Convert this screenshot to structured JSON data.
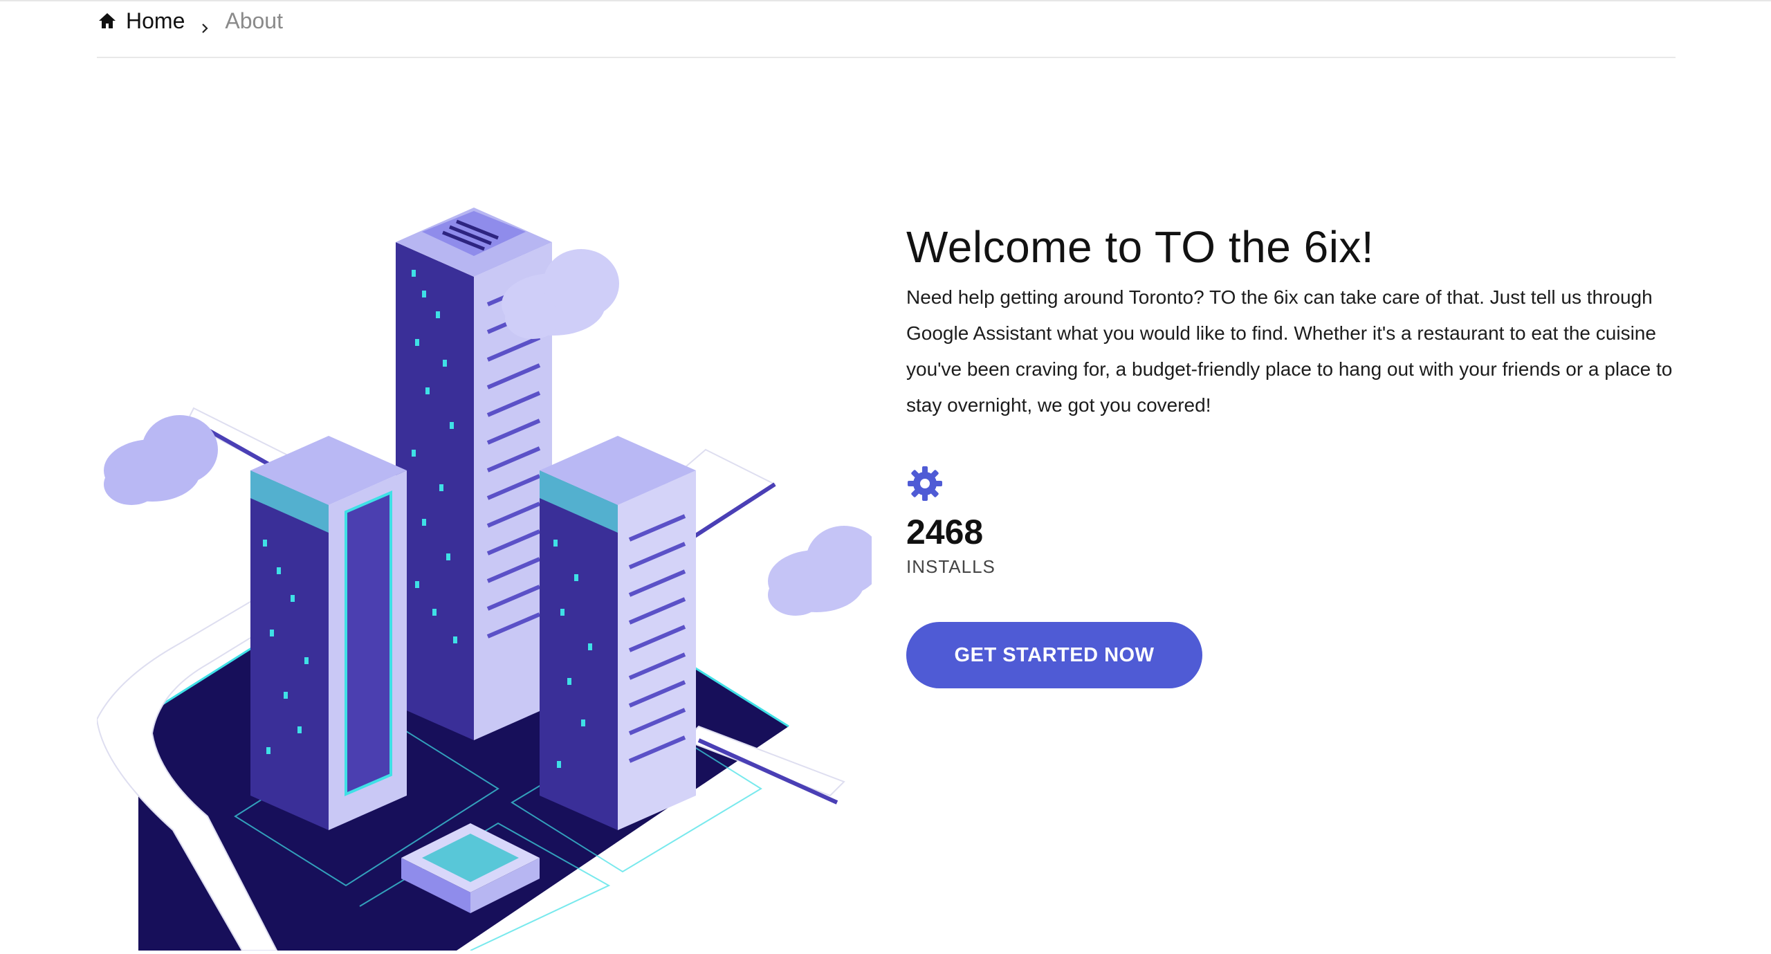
{
  "breadcrumb": {
    "home_icon": "home-icon",
    "home_label": "Home",
    "separator_icon": "chevron-right-icon",
    "current_label": "About"
  },
  "hero": {
    "title": "Welcome to TO the 6ix!",
    "description": "Need help getting around Toronto? TO the 6ix can take care of that. Just tell us through Google Assistant what you would like to find. Whether it's a restaurant to eat the cuisine you've been craving for, a budget-friendly place to hang out with your friends or a place to stay overnight, we got you covered!"
  },
  "stat": {
    "icon": "gear-icon",
    "value": "2468",
    "label": "INSTALLS"
  },
  "cta": {
    "label": "GET STARTED NOW"
  },
  "colors": {
    "accent": "#4f5bd5",
    "building_dark": "#3a2f98",
    "building_light": "#c9c8f5",
    "window_cyan": "#3fe0e6"
  }
}
